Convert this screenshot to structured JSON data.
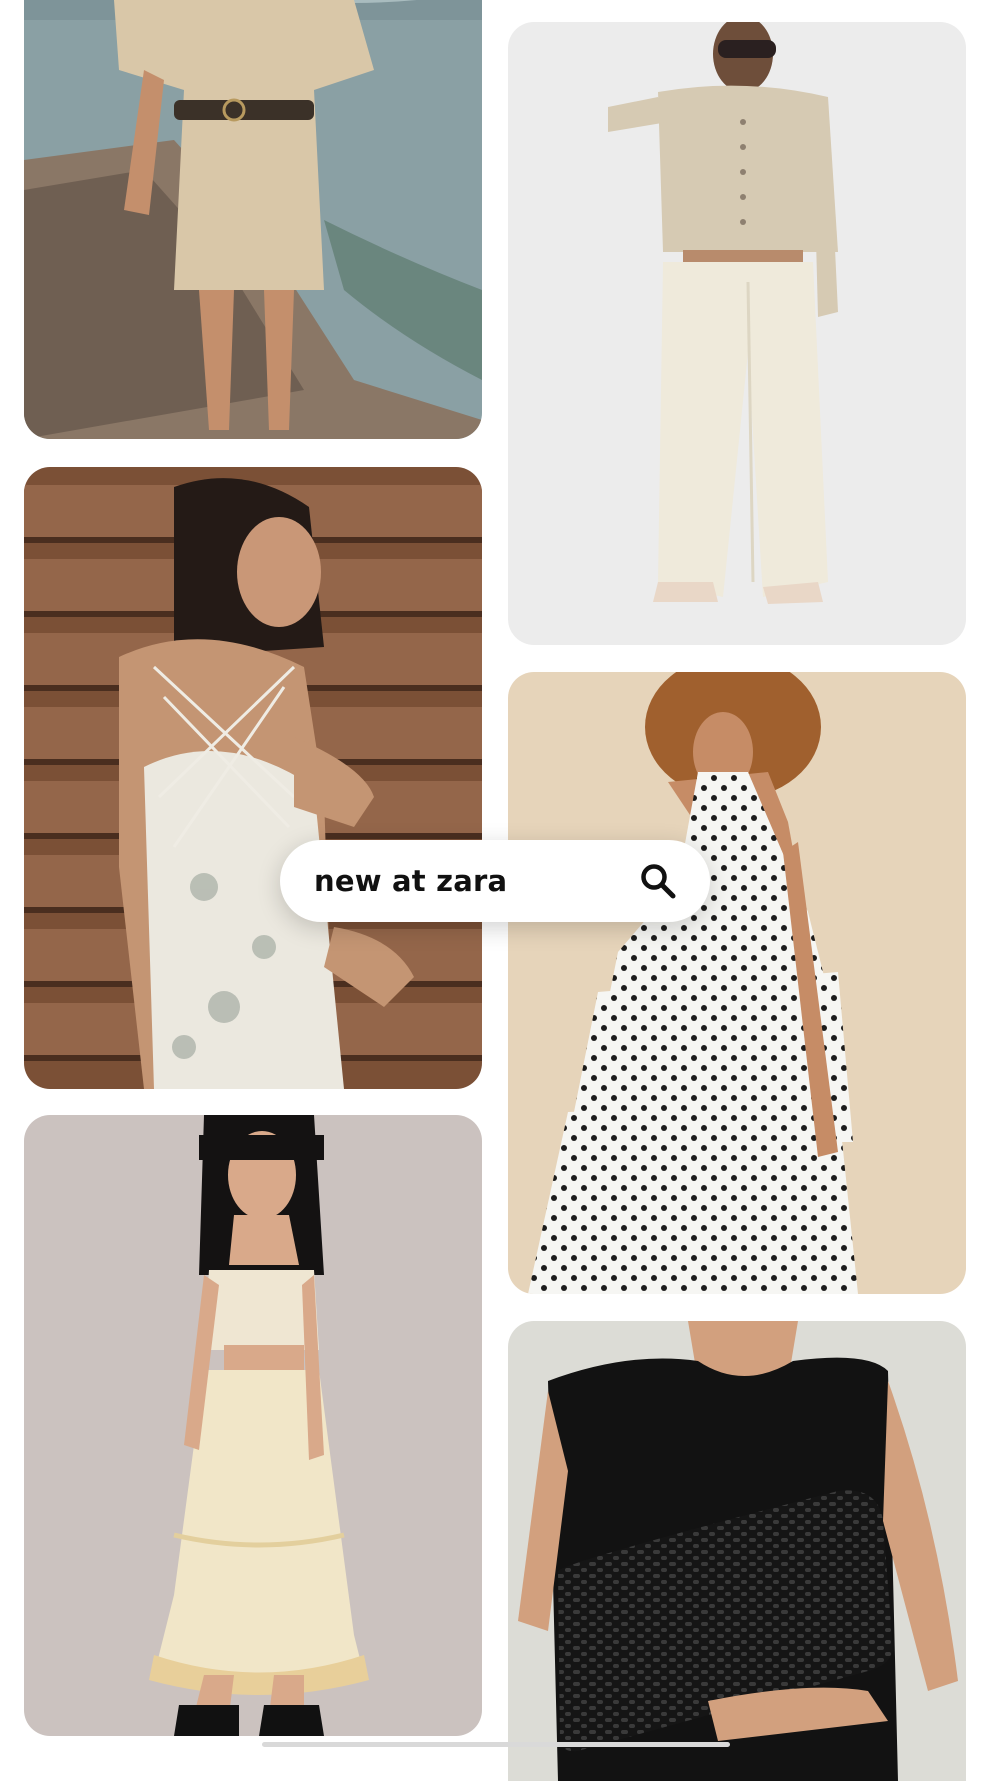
{
  "search": {
    "query": "new at zara"
  },
  "icons": {
    "search": "search-icon"
  },
  "pins": [
    {
      "subject": "linen-romper-by-sea",
      "background": "#8ea3a6"
    },
    {
      "subject": "backless-floral-slip-dress",
      "background": "#7a5238"
    },
    {
      "subject": "lace-crop-top-and-tiered-skirt",
      "background": "#c9c0bd"
    },
    {
      "subject": "cardigan-and-cream-trousers",
      "background": "#ebebeb"
    },
    {
      "subject": "polka-dot-ruffle-set",
      "background": "#e5d3b9"
    },
    {
      "subject": "black-dress-woven-clutch",
      "background": "#dcdcd6"
    }
  ]
}
